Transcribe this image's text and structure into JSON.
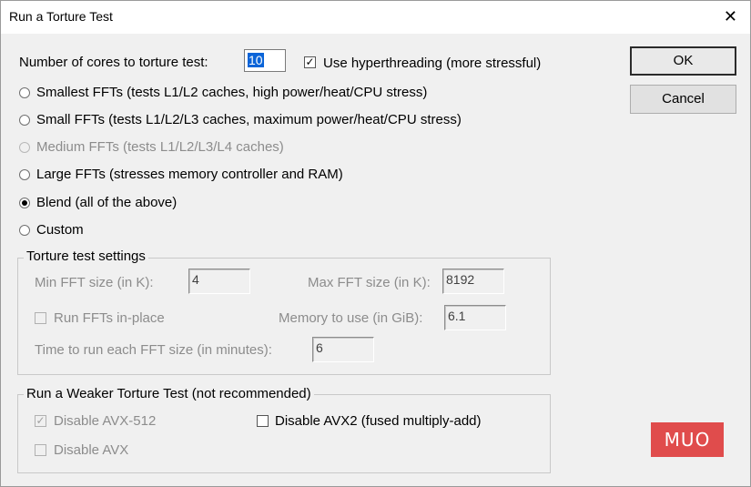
{
  "window": {
    "title": "Run a Torture Test"
  },
  "cores": {
    "label": "Number of cores to torture test:",
    "value": "10"
  },
  "hyperthreading": {
    "label": "Use hyperthreading (more stressful)",
    "checked": true
  },
  "options": [
    {
      "label": "Smallest FFTs (tests L1/L2 caches, high power/heat/CPU stress)",
      "checked": false,
      "enabled": true
    },
    {
      "label": "Small FFTs (tests L1/L2/L3 caches, maximum power/heat/CPU stress)",
      "checked": false,
      "enabled": true
    },
    {
      "label": "Medium FFTs (tests L1/L2/L3/L4 caches)",
      "checked": false,
      "enabled": false
    },
    {
      "label": "Large FFTs (stresses memory controller and RAM)",
      "checked": false,
      "enabled": true
    },
    {
      "label": "Blend (all of the above)",
      "checked": true,
      "enabled": true
    },
    {
      "label": "Custom",
      "checked": false,
      "enabled": true
    }
  ],
  "settings": {
    "title": "Torture test settings",
    "min_fft_label": "Min FFT size (in K):",
    "min_fft_value": "4",
    "max_fft_label": "Max FFT size (in K):",
    "max_fft_value": "8192",
    "in_place_label": "Run FFTs in-place",
    "memory_label": "Memory to use (in GiB):",
    "memory_value": "6.1",
    "time_label": "Time to run each FFT size (in minutes):",
    "time_value": "6"
  },
  "weaker": {
    "title": "Run a Weaker Torture Test (not recommended)",
    "avx512_label": "Disable AVX-512",
    "avx512_checked": true,
    "avx2_label": "Disable AVX2 (fused multiply-add)",
    "avx2_checked": false,
    "avx_label": "Disable AVX",
    "avx_checked": false
  },
  "buttons": {
    "ok": "OK",
    "cancel": "Cancel"
  },
  "watermark": "MUO",
  "icons": {
    "close": "close-icon",
    "check": "✓"
  }
}
